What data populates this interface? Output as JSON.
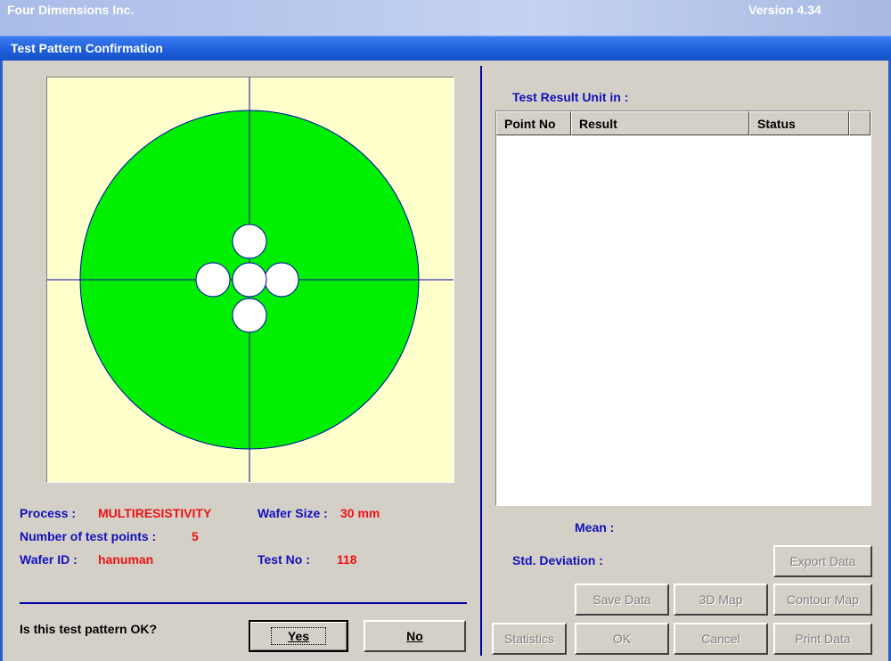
{
  "window": {
    "app_title": "Four Dimensions Inc.",
    "version": "Version 4.34",
    "dialog_title": "Test Pattern Confirmation"
  },
  "wafer": {
    "process_label": "Process :",
    "process_value": "MULTIRESISTIVITY",
    "wafer_size_label": "Wafer Size :",
    "wafer_size_value": "30 mm",
    "points_label": "Number of test points :",
    "points_value": "5",
    "wafer_id_label": "Wafer ID :",
    "wafer_id_value": "hanuman",
    "test_no_label": "Test No :",
    "test_no_value": "118",
    "colors": {
      "background": "#ffffcc",
      "wafer": "#00ee00",
      "crosshair": "#0000aa",
      "point": "#ffffff"
    }
  },
  "confirm": {
    "question": "Is this test pattern OK?",
    "yes_label": "Yes",
    "no_label": "No"
  },
  "results": {
    "unit_label": "Test Result Unit in :",
    "columns": [
      "Point No",
      "Result",
      "Status"
    ],
    "rows": [],
    "mean_label": "Mean :",
    "std_label": "Std. Deviation :"
  },
  "buttons": {
    "export_data": "Export Data",
    "save_data": "Save Data",
    "map_3d": "3D Map",
    "contour_map": "Contour Map",
    "statistics": "Statistics",
    "ok": "OK",
    "cancel": "Cancel",
    "print_data": "Print Data"
  }
}
